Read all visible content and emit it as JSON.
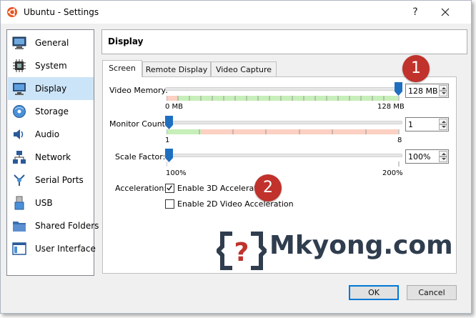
{
  "window": {
    "title": "Ubuntu - Settings",
    "help_glyph": "?"
  },
  "sidebar": {
    "items": [
      {
        "label": "General",
        "icon": "general-icon",
        "active": false
      },
      {
        "label": "System",
        "icon": "system-icon",
        "active": false
      },
      {
        "label": "Display",
        "icon": "display-icon",
        "active": true
      },
      {
        "label": "Storage",
        "icon": "storage-icon",
        "active": false
      },
      {
        "label": "Audio",
        "icon": "audio-icon",
        "active": false
      },
      {
        "label": "Network",
        "icon": "network-icon",
        "active": false
      },
      {
        "label": "Serial Ports",
        "icon": "serial-ports-icon",
        "active": false
      },
      {
        "label": "USB",
        "icon": "usb-icon",
        "active": false
      },
      {
        "label": "Shared Folders",
        "icon": "shared-folders-icon",
        "active": false
      },
      {
        "label": "User Interface",
        "icon": "user-interface-icon",
        "active": false
      }
    ]
  },
  "section": {
    "title": "Display"
  },
  "tabs": [
    {
      "label": "Screen",
      "active": true
    },
    {
      "label": "Remote Display",
      "active": false
    },
    {
      "label": "Video Capture",
      "active": false
    }
  ],
  "video_memory": {
    "label": "Video Memory:",
    "value": "128 MB",
    "min_label": "0 MB",
    "max_label": "128 MB",
    "fraction": 1.0
  },
  "monitor_count": {
    "label": "Monitor Count:",
    "value": "1",
    "min_label": "1",
    "max_label": "8",
    "fraction": 0.0
  },
  "scale_factor": {
    "label": "Scale Factor:",
    "value": "100%",
    "min_label": "100%",
    "max_label": "200%",
    "fraction": 0.0
  },
  "acceleration": {
    "label": "Acceleration:",
    "enable_3d": {
      "label": "Enable 3D Acceleration",
      "checked": true
    },
    "enable_2d": {
      "label": "Enable 2D Video Acceleration",
      "checked": false
    }
  },
  "annotations": [
    {
      "text": "1"
    },
    {
      "text": "2"
    }
  ],
  "watermark": {
    "text": "Mkyong.com",
    "logo_glyph": "?"
  },
  "buttons": {
    "ok": "OK",
    "cancel": "Cancel"
  },
  "colors": {
    "selection": "#cce4f7",
    "badge": "#c0322b",
    "slider_thumb": "#1f6fc1",
    "band_red": "#fcd0c2",
    "band_green": "#c7efb9",
    "default_button_border": "#0078d7"
  }
}
